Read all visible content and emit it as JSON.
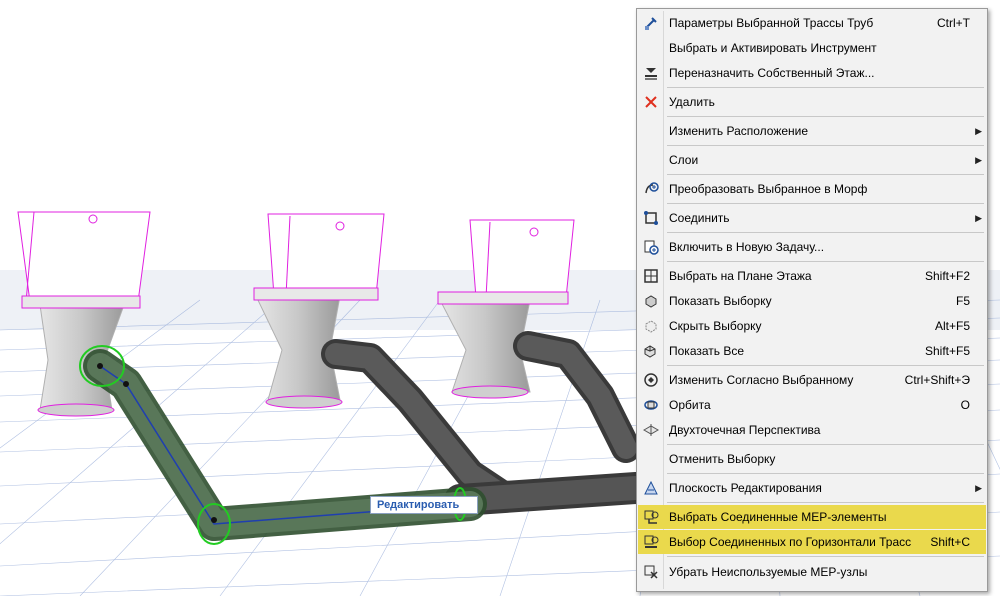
{
  "scene": {
    "edit_tag": "Редактировать",
    "colors": {
      "selection": "#22cc22",
      "pipe": "#4d4d4d",
      "grid": "#8fa6d6",
      "outline": "#e020e0"
    }
  },
  "menu": {
    "items": [
      {
        "label": "Параметры Выбранной Трассы Труб",
        "shortcut": "Ctrl+T",
        "icon": "pipe-settings-icon"
      },
      {
        "label": "Выбрать и Активировать Инструмент",
        "shortcut": "",
        "icon": ""
      },
      {
        "label": "Переназначить Собственный Этаж...",
        "shortcut": "",
        "icon": "story-icon"
      },
      {
        "label": "Удалить",
        "shortcut": "",
        "icon": "delete-icon"
      },
      {
        "label": "Изменить Расположение",
        "shortcut": "",
        "icon": "",
        "submenu": true
      },
      {
        "label": "Слои",
        "shortcut": "",
        "icon": "",
        "submenu": true
      },
      {
        "label": "Преобразовать Выбранное в Морф",
        "shortcut": "",
        "icon": "morph-icon"
      },
      {
        "label": "Соединить",
        "shortcut": "",
        "icon": "connect-icon",
        "submenu": true
      },
      {
        "label": "Включить в Новую Задачу...",
        "shortcut": "",
        "icon": "new-task-icon"
      },
      {
        "label": "Выбрать на Плане Этажа",
        "shortcut": "Shift+F2",
        "icon": "select-on-plan-icon"
      },
      {
        "label": "Показать Выборку",
        "shortcut": "F5",
        "icon": "show-selection-icon"
      },
      {
        "label": "Скрыть Выборку",
        "shortcut": "Alt+F5",
        "icon": "hide-selection-icon"
      },
      {
        "label": "Показать Все",
        "shortcut": "Shift+F5",
        "icon": "show-all-icon"
      },
      {
        "label": "Изменить Согласно Выбранному",
        "shortcut": "Ctrl+Shift+Э",
        "icon": "fit-selection-icon"
      },
      {
        "label": "Орбита",
        "shortcut": "O",
        "icon": "orbit-icon"
      },
      {
        "label": "Двухточечная Перспектива",
        "shortcut": "",
        "icon": "two-point-perspective-icon"
      },
      {
        "label": "Отменить Выборку",
        "shortcut": "",
        "icon": ""
      },
      {
        "label": "Плоскость Редактирования",
        "shortcut": "",
        "icon": "editing-plane-icon",
        "submenu": true
      },
      {
        "label": "Выбрать Соединенные MEP-элементы",
        "shortcut": "",
        "icon": "mep-connected-icon",
        "highlighted": true
      },
      {
        "label": "Выбор Соединенных по Горизонтали Трасс",
        "shortcut": "Shift+C",
        "icon": "mep-horizontal-icon",
        "highlighted": true
      },
      {
        "label": "Убрать Неиспользуемые MEP-узлы",
        "shortcut": "",
        "icon": "mep-cleanup-icon"
      }
    ]
  }
}
